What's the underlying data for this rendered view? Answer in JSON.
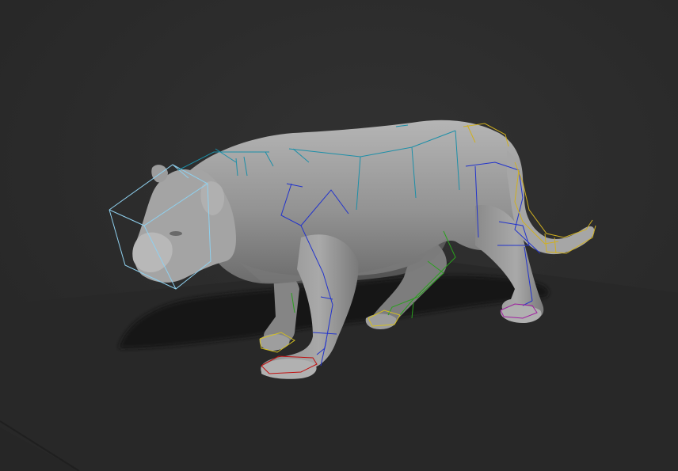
{
  "viewport": {
    "background_color": "#2a2a2a",
    "ground_color": "#272727",
    "shadow_color": "#121212",
    "model_color": "#9a9a9a"
  },
  "model": {
    "subject": "tiger-3d-mesh",
    "rig_visible": true
  },
  "rig": {
    "colors": {
      "head": "#8fd0ee",
      "spine": "#1c8fa8",
      "front_leg": "#2233cc",
      "back_leg": "#2aa01e",
      "paw_front": "#d4c020",
      "paw_back_red": "#c01010",
      "tail": "#d0b020",
      "foot_magenta": "#a020a0"
    }
  }
}
